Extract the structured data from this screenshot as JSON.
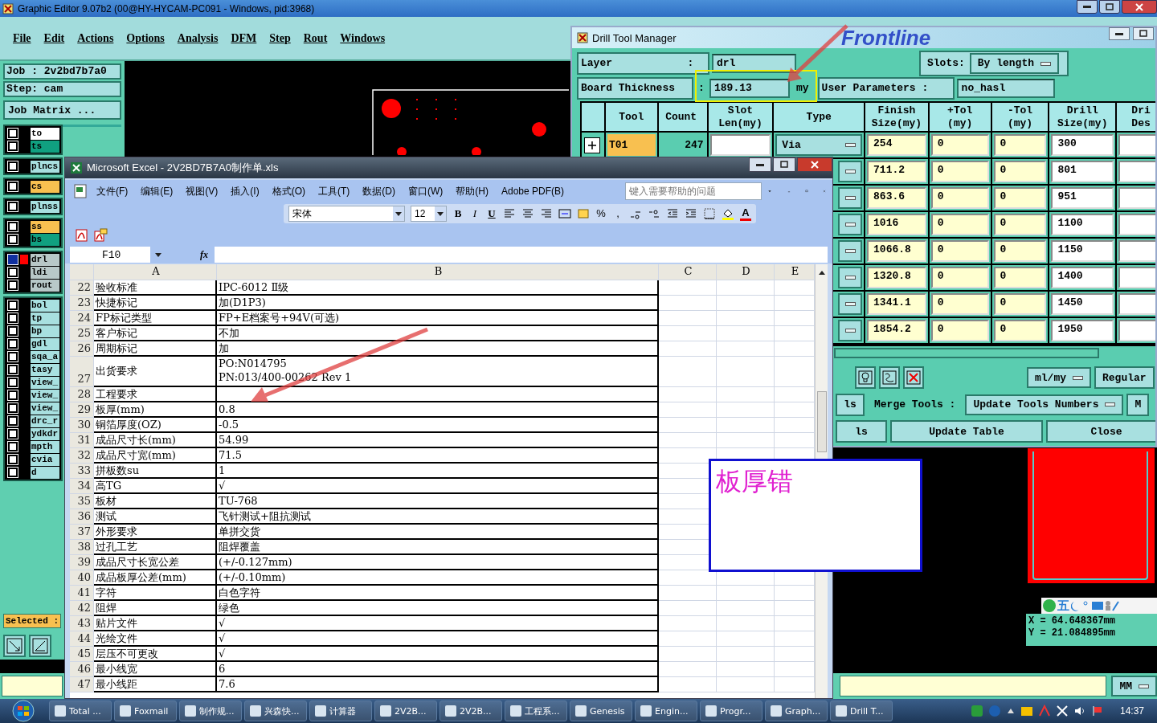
{
  "editor": {
    "title": "Graphic Editor 9.07b2 (00@HY-HYCAM-PC091 - Windows, pid:3968)",
    "menu": [
      "File",
      "Edit",
      "Actions",
      "Options",
      "Analysis",
      "DFM",
      "Step",
      "Rout",
      "Windows"
    ],
    "job": "Job : 2v2bd7b7a0",
    "step": "Step: cam",
    "job_matrix": "Job Matrix ...",
    "layer_groups": [
      [
        {
          "name": "to",
          "color": "#ffffff",
          "selected": false,
          "active": false
        },
        {
          "name": "ts",
          "color": "#10a080",
          "selected": false,
          "active": false
        }
      ],
      [
        {
          "name": "plncs",
          "color": "#a8e0e0",
          "selected": false,
          "active": false
        }
      ],
      [
        {
          "name": "cs",
          "color": "#f8c050",
          "selected": false,
          "active": false
        }
      ],
      [
        {
          "name": "plnss",
          "color": "#a8e0e0",
          "selected": false,
          "active": false
        }
      ],
      [
        {
          "name": "ss",
          "color": "#f8c050",
          "selected": false,
          "active": false
        },
        {
          "name": "bs",
          "color": "#10a080",
          "selected": false,
          "active": false
        }
      ],
      [
        {
          "name": "drl",
          "color": "#b8c8c8",
          "selected": true,
          "active": true
        },
        {
          "name": "ldi",
          "color": "#b8c8c8",
          "selected": false,
          "active": false
        },
        {
          "name": "rout",
          "color": "#b8c8c8",
          "selected": false,
          "active": false
        }
      ],
      [
        {
          "name": "bol",
          "color": "#a8e0e0",
          "selected": false,
          "active": false
        },
        {
          "name": "tp",
          "color": "#a8e0e0",
          "selected": false,
          "active": false
        },
        {
          "name": "bp",
          "color": "#a8e0e0",
          "selected": false,
          "active": false
        },
        {
          "name": "gdl",
          "color": "#a8e0e0",
          "selected": false,
          "active": false
        },
        {
          "name": "sqa_a",
          "color": "#a8e0e0",
          "selected": false,
          "active": false
        },
        {
          "name": "tasy",
          "color": "#a8e0e0",
          "selected": false,
          "active": false
        },
        {
          "name": "view_",
          "color": "#a8e0e0",
          "selected": false,
          "active": false
        },
        {
          "name": "view_",
          "color": "#a8e0e0",
          "selected": false,
          "active": false
        },
        {
          "name": "view_",
          "color": "#a8e0e0",
          "selected": false,
          "active": false
        },
        {
          "name": "drc_r",
          "color": "#a8e0e0",
          "selected": false,
          "active": false
        },
        {
          "name": "ydkdr",
          "color": "#a8e0e0",
          "selected": false,
          "active": false
        },
        {
          "name": "mpth",
          "color": "#a8e0e0",
          "selected": false,
          "active": false
        },
        {
          "name": "cvia",
          "color": "#a8e0e0",
          "selected": false,
          "active": false
        },
        {
          "name": "d",
          "color": "#a8e0e0",
          "selected": false,
          "active": false
        }
      ]
    ],
    "selected_label": "Selected :",
    "coords": [
      "X = 64.648367mm",
      "Y = 21.084895mm"
    ],
    "units": "MM",
    "ime": "五"
  },
  "drill": {
    "title": "Drill Tool Manager",
    "logo": "Frontline",
    "layer_label": "Layer",
    "layer_sep": ":",
    "layer": "drl",
    "slots_label": "Slots:",
    "slots": "By length",
    "thickness_label": "Board Thickness",
    "thickness_sep": ":",
    "thickness": "189.13",
    "thickness_unit": "my",
    "params_label": "User Parameters :",
    "params": "no_hasl",
    "columns": [
      [
        "Tool"
      ],
      [
        "Count"
      ],
      [
        "Slot",
        "Len(my)"
      ],
      [
        "Type"
      ],
      [
        "Finish",
        "Size(my)"
      ],
      [
        "+Tol",
        "(my)"
      ],
      [
        "-Tol",
        "(my)"
      ],
      [
        "Drill",
        "Size(my)"
      ],
      [
        "Dri",
        "Des"
      ]
    ],
    "rows": [
      {
        "tool": "T01",
        "count": "247",
        "type": "Via",
        "finish": "254",
        "ptol": "0",
        "mtol": "0",
        "drill": "300"
      },
      {
        "finish": "711.2",
        "ptol": "0",
        "mtol": "0",
        "drill": "801"
      },
      {
        "finish": "863.6",
        "ptol": "0",
        "mtol": "0",
        "drill": "951"
      },
      {
        "finish": "1016",
        "ptol": "0",
        "mtol": "0",
        "drill": "1100"
      },
      {
        "finish": "1066.8",
        "ptol": "0",
        "mtol": "0",
        "drill": "1150"
      },
      {
        "finish": "1320.8",
        "ptol": "0",
        "mtol": "0",
        "drill": "1400"
      },
      {
        "finish": "1341.1",
        "ptol": "0",
        "mtol": "0",
        "drill": "1450"
      },
      {
        "finish": "1854.2",
        "ptol": "0",
        "mtol": "0",
        "drill": "1950"
      }
    ],
    "units": "ml/my",
    "mode": "Regular",
    "merge_left": "ls",
    "merge_label": "Merge Tools :",
    "merge": "Update Tools Numbers",
    "merge_right": "M",
    "bottom_left": "ls",
    "update": "Update Table",
    "close": "Close"
  },
  "excel": {
    "title": "Microsoft Excel - 2V2BD7B7A0制作单.xls",
    "menu": [
      "文件(F)",
      "编辑(E)",
      "视图(V)",
      "插入(I)",
      "格式(O)",
      "工具(T)",
      "数据(D)",
      "窗口(W)",
      "帮助(H)",
      "Adobe PDF(B)"
    ],
    "help_placeholder": "键入需要帮助的问题",
    "toolbar_labels": {
      "bold": "B",
      "italic": "I",
      "underline": "U",
      "percent": "%",
      "comma": ",",
      "font_color": "A"
    },
    "font": "宋体",
    "size": "12",
    "name_box": "F10",
    "fx": "fx",
    "columns": [
      "A",
      "B",
      "C",
      "D",
      "E"
    ],
    "rows": [
      [
        "22",
        "验收标准",
        "IPC-6012 Ⅱ级"
      ],
      [
        "23",
        "快捷标记",
        "加(D1P3)"
      ],
      [
        "24",
        "FP标记类型",
        "FP+E档案号+94V(可选)"
      ],
      [
        "25",
        "客户标记",
        "不加"
      ],
      [
        "26",
        "周期标记",
        "加"
      ],
      [
        "27",
        "出货要求",
        "PO:N014795\nPN:013/400-00262 Rev 1"
      ],
      [
        "28",
        "工程要求",
        ""
      ],
      [
        "29",
        "板厚(mm)",
        "0.8"
      ],
      [
        "30",
        "铜箔厚度(OZ)",
        "-0.5"
      ],
      [
        "31",
        "成品尺寸长(mm)",
        "54.99"
      ],
      [
        "32",
        "成品尺寸宽(mm)",
        "71.5"
      ],
      [
        "33",
        "拼板数su",
        "1"
      ],
      [
        "34",
        "高TG",
        "√"
      ],
      [
        "35",
        "板材",
        "TU-768"
      ],
      [
        "36",
        "测试",
        "飞针测试+阻抗测试"
      ],
      [
        "37",
        "外形要求",
        "单拼交货"
      ],
      [
        "38",
        "过孔工艺",
        "阻焊覆盖"
      ],
      [
        "39",
        "成品尺寸长宽公差",
        "(+/-0.127mm)"
      ],
      [
        "40",
        "成品板厚公差(mm)",
        "(+/-0.10mm)"
      ],
      [
        "41",
        "字符",
        "白色字符"
      ],
      [
        "42",
        "阻焊",
        "绿色"
      ],
      [
        "43",
        "贴片文件",
        "√"
      ],
      [
        "44",
        "光绘文件",
        "√"
      ],
      [
        "45",
        "层压不可更改",
        "√"
      ],
      [
        "46",
        "最小线宽",
        "6"
      ],
      [
        "47",
        "最小线距",
        "7.6"
      ]
    ]
  },
  "note": "板厚错",
  "taskbar": {
    "items": [
      "Total ...",
      "Foxmail",
      "制作规...",
      "兴森快...",
      "计算器",
      "2V2B...",
      "2V2B...",
      "工程系...",
      "Genesis",
      "Engin...",
      "Progr...",
      "Graph...",
      "Drill T..."
    ],
    "time": "14:37"
  }
}
